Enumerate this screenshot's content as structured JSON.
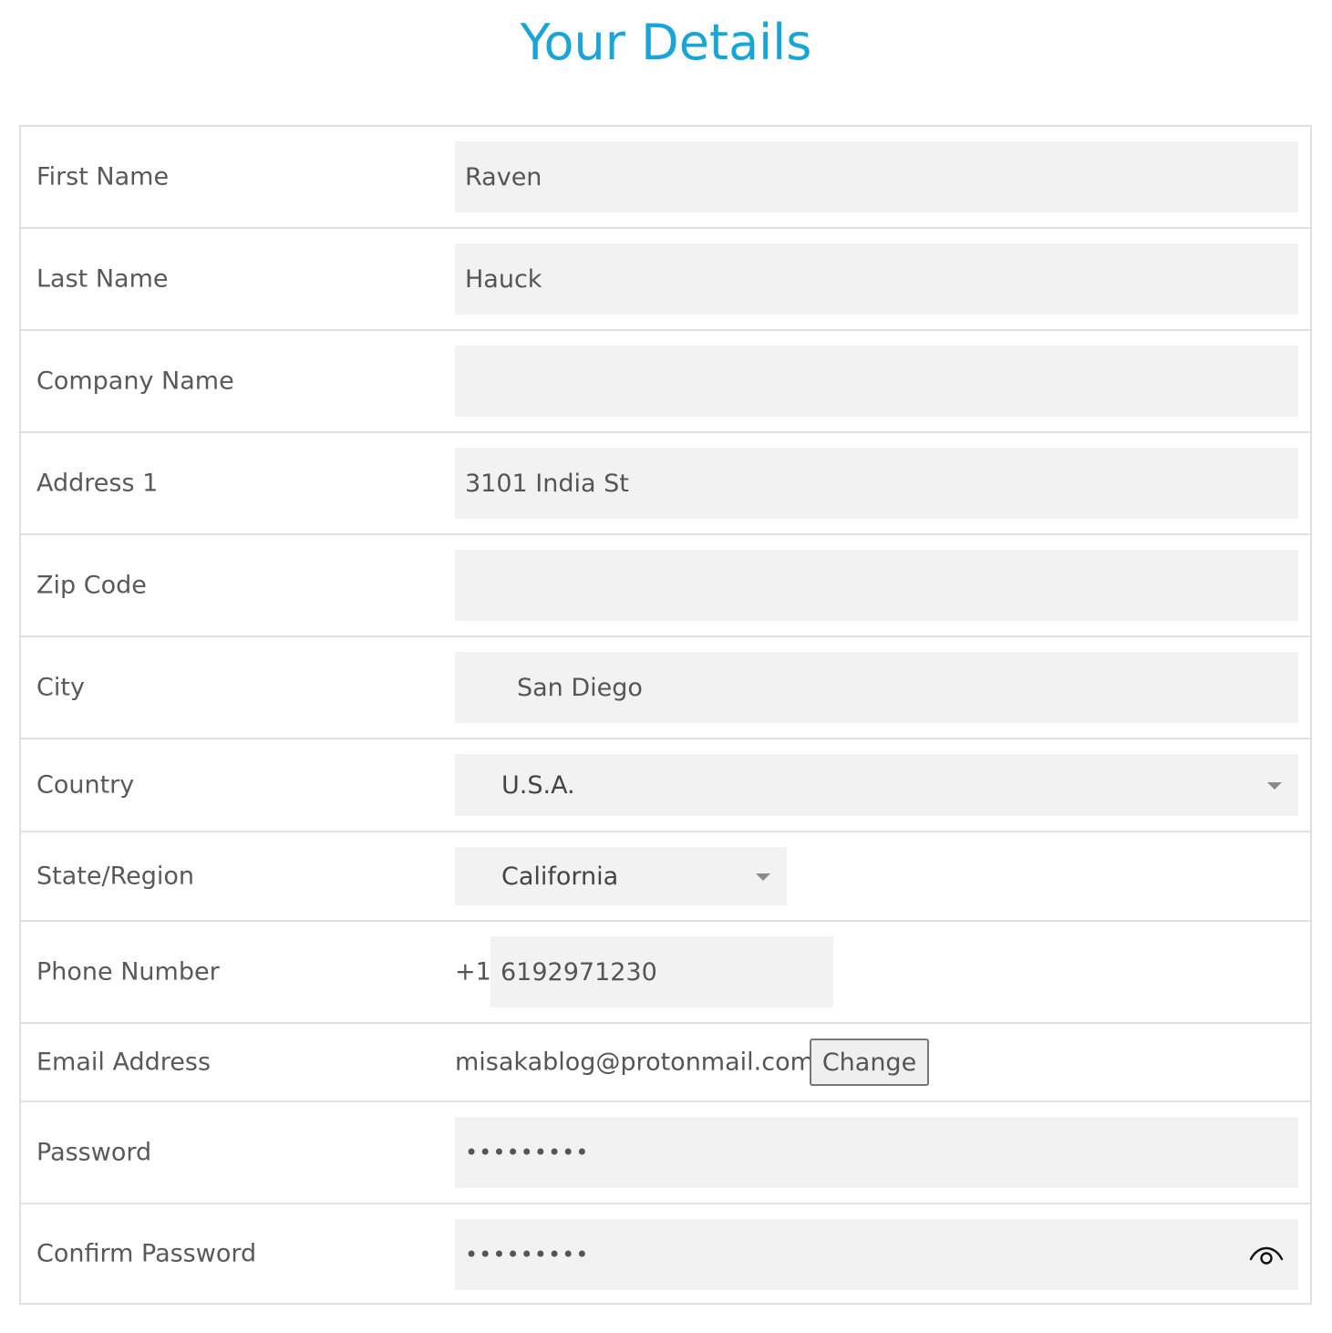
{
  "page": {
    "title": "Your Details"
  },
  "form": {
    "first_name": {
      "label": "First Name",
      "value": "Raven"
    },
    "last_name": {
      "label": "Last Name",
      "value": "Hauck"
    },
    "company_name": {
      "label": "Company Name",
      "value": ""
    },
    "address1": {
      "label": "Address 1",
      "value": "3101 India St"
    },
    "zip_code": {
      "label": "Zip Code",
      "value": ""
    },
    "city": {
      "label": "City",
      "value": "San Diego"
    },
    "country": {
      "label": "Country",
      "selected": "U.S.A."
    },
    "state": {
      "label": "State/Region",
      "selected": "California"
    },
    "phone": {
      "label": "Phone Number",
      "prefix": "+1",
      "value": "6192971230"
    },
    "email": {
      "label": "Email Address",
      "value": "misakablog@protonmail.com",
      "change_label": "Change"
    },
    "password": {
      "label": "Password",
      "value": "•••••••••"
    },
    "confirm_password": {
      "label": "Confirm Password",
      "value": "•••••••••"
    }
  },
  "icons": {
    "caret": "chevron-down-icon",
    "reveal": "eye-icon"
  },
  "colors": {
    "title": "#1aa5d8",
    "field_bg": "#f2f2f2",
    "border": "#e0e0e0"
  }
}
